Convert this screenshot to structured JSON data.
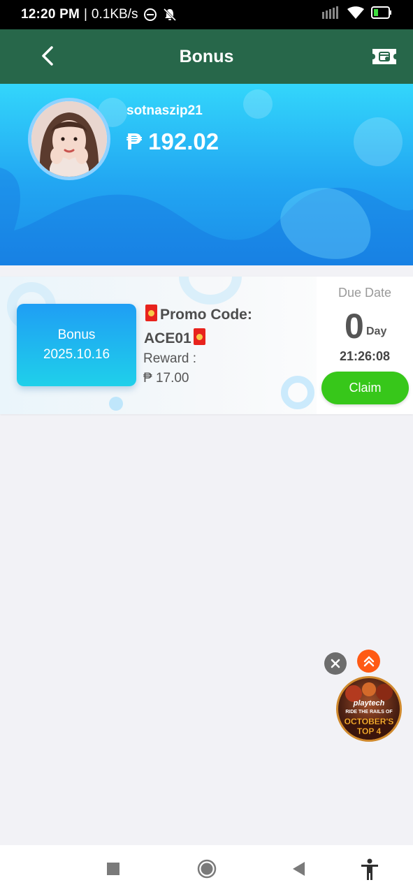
{
  "status_bar": {
    "time": "12:20 PM",
    "net_speed": "0.1KB/s",
    "icons": [
      "dnd-icon",
      "bell-off-icon",
      "signal-icon",
      "wifi-icon",
      "battery-icon"
    ]
  },
  "header": {
    "title": "Bonus",
    "back_icon": "chevron-left-icon",
    "action_icon": "ticket-icon",
    "bg_color": "#27674a"
  },
  "profile": {
    "username": "sotnaszip21",
    "balance": "₱ 192.02"
  },
  "promo_card": {
    "tile_title": "Bonus",
    "tile_date": "2025.10.16",
    "promo_label": "Promo Code:",
    "promo_code": "ACE01",
    "reward_label": "Reward :",
    "reward_value": "₱ 17.00",
    "due_label": "Due Date",
    "due_days": "0",
    "due_unit": "Day",
    "due_time": "21:26:08",
    "claim_label": "Claim",
    "claim_color": "#37c71a"
  },
  "floating_ad": {
    "brand": "playtech",
    "line1": "RIDE THE RAILS OF",
    "line2": "OCTOBER'S",
    "line3": "TOP 4"
  },
  "nav_bar": {
    "icons": [
      "recents-square-icon",
      "home-circle-icon",
      "back-triangle-icon",
      "accessibility-icon"
    ]
  }
}
